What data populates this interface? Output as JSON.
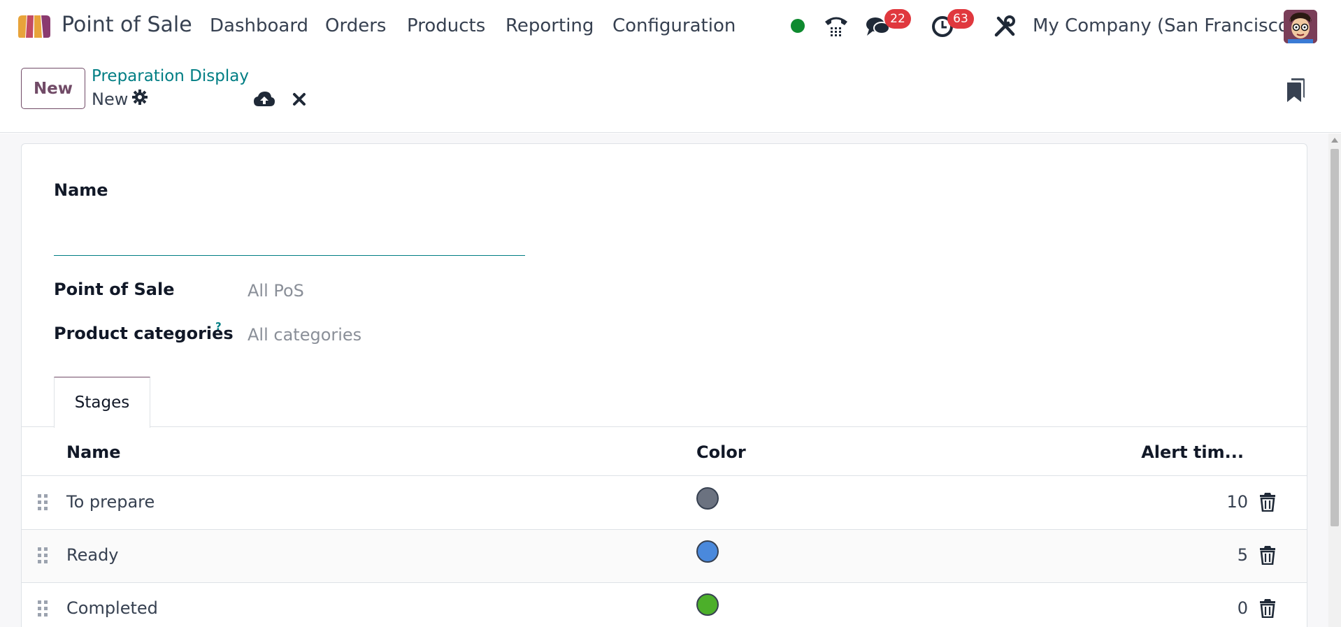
{
  "navbar": {
    "app_name": "Point of Sale",
    "menu": [
      "Dashboard",
      "Orders",
      "Products",
      "Reporting",
      "Configuration"
    ],
    "messages_count": "22",
    "activities_count": "63",
    "company": "My Company (San Francisco)",
    "status_color": "#0e8a2f",
    "badge_color": "#e0383e"
  },
  "control_panel": {
    "new_label": "New",
    "breadcrumb": "Preparation Display",
    "record_title": "New"
  },
  "form": {
    "name_label": "Name",
    "name_value": "",
    "pos_label": "Point of Sale",
    "pos_value": "All PoS",
    "categories_label": "Product categories",
    "categories_help": "?",
    "categories_value": "All categories",
    "tab_label": "Stages"
  },
  "stages_table": {
    "columns": [
      "Name",
      "Color",
      "Alert tim..."
    ],
    "rows": [
      {
        "name": "To prepare",
        "color": "#6b7280",
        "alert": "10"
      },
      {
        "name": "Ready",
        "color": "#4a89dc",
        "alert": "5"
      },
      {
        "name": "Completed",
        "color": "#4caf2a",
        "alert": "0"
      }
    ]
  },
  "colors": {
    "accent": "#017e84",
    "brand": "#714b67"
  }
}
